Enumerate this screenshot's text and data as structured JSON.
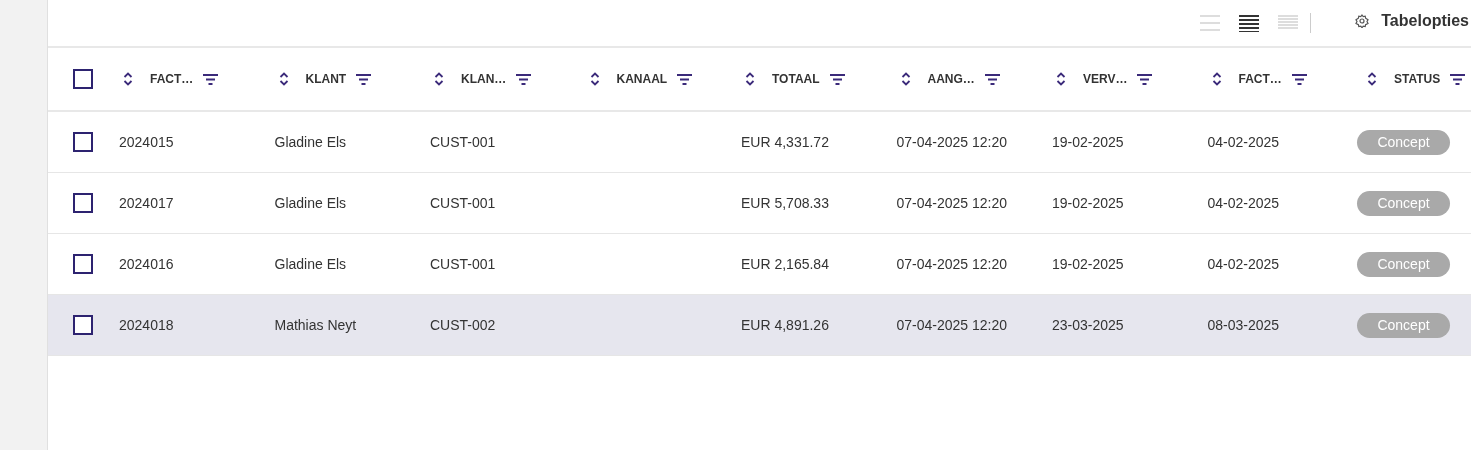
{
  "toolbar": {
    "density_options": [
      {
        "selected": false
      },
      {
        "selected": true
      },
      {
        "selected": false
      }
    ],
    "table_options": "Tabelopties"
  },
  "table": {
    "columns": [
      "FACT…",
      "KLANT",
      "KLAN…",
      "KANAAL",
      "TOTAAL",
      "AANG…",
      "VERV…",
      "FACT…",
      "STATUS"
    ],
    "all_checked": false,
    "rows": [
      {
        "checked": false,
        "highlighted": false,
        "cells": [
          "2024015",
          "Gladine Els",
          "CUST-001",
          "",
          "EUR 4,331.72",
          "07-04-2025 12:20",
          "19-02-2025",
          "04-02-2025"
        ],
        "status": "Concept"
      },
      {
        "checked": false,
        "highlighted": false,
        "cells": [
          "2024017",
          "Gladine Els",
          "CUST-001",
          "",
          "EUR 5,708.33",
          "07-04-2025 12:20",
          "19-02-2025",
          "04-02-2025"
        ],
        "status": "Concept"
      },
      {
        "checked": false,
        "highlighted": false,
        "cells": [
          "2024016",
          "Gladine Els",
          "CUST-001",
          "",
          "EUR 2,165.84",
          "07-04-2025 12:20",
          "19-02-2025",
          "04-02-2025"
        ],
        "status": "Concept"
      },
      {
        "checked": false,
        "highlighted": true,
        "cells": [
          "2024018",
          "Mathias Neyt",
          "CUST-002",
          "",
          "EUR 4,891.26",
          "07-04-2025 12:20",
          "23-03-2025",
          "08-03-2025"
        ],
        "status": "Concept"
      }
    ]
  }
}
